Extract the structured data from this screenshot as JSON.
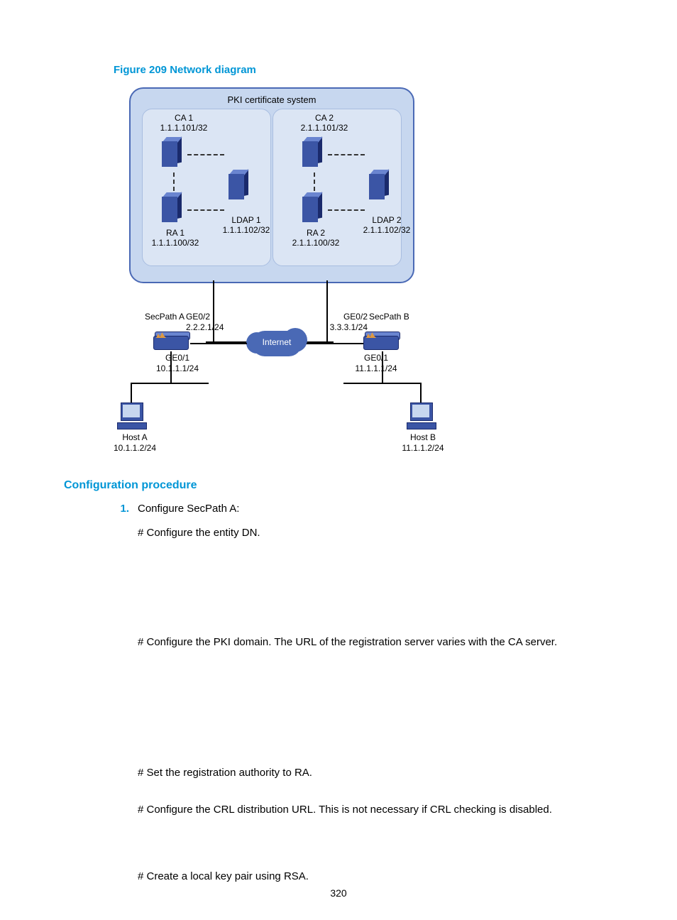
{
  "figure_title": "Figure 209 Network diagram",
  "section_title": "Configuration procedure",
  "list_number": "1.",
  "step1_title": "Configure SecPath A:",
  "step1a": "# Configure the entity DN.",
  "step2": "# Configure the PKI domain. The URL of the registration server varies with the CA server.",
  "step3": "# Set the registration authority to RA.",
  "step4": "# Configure the CRL distribution URL. This is not necessary if CRL checking is disabled.",
  "step5": "# Create a local key pair using RSA.",
  "page_number": "320",
  "diagram": {
    "pki_title": "PKI certificate system",
    "ca1_name": "CA 1",
    "ca1_ip": "1.1.1.101/32",
    "ca2_name": "CA 2",
    "ca2_ip": "2.1.1.101/32",
    "ra1_name": "RA 1",
    "ra1_ip": "1.1.1.100/32",
    "ra2_name": "RA 2",
    "ra2_ip": "2.1.1.100/32",
    "ldap1_name": "LDAP 1",
    "ldap1_ip": "1.1.1.102/32",
    "ldap2_name": "LDAP 2",
    "ldap2_ip": "2.1.1.102/32",
    "internet": "Internet",
    "secpath_a": "SecPath A",
    "secpath_b": "SecPath B",
    "spa_ge02": "GE0/2",
    "spa_ge02_ip": "2.2.2.1/24",
    "spb_ge02": "GE0/2",
    "spb_ge02_ip": "3.3.3.1/24",
    "spa_ge01": "GE0/1",
    "spa_ge01_ip": "10.1.1.1/24",
    "spb_ge01": "GE0/1",
    "spb_ge01_ip": "11.1.1.1/24",
    "host_a": "Host A",
    "host_a_ip": "10.1.1.2/24",
    "host_b": "Host B",
    "host_b_ip": "11.1.1.2/24"
  }
}
